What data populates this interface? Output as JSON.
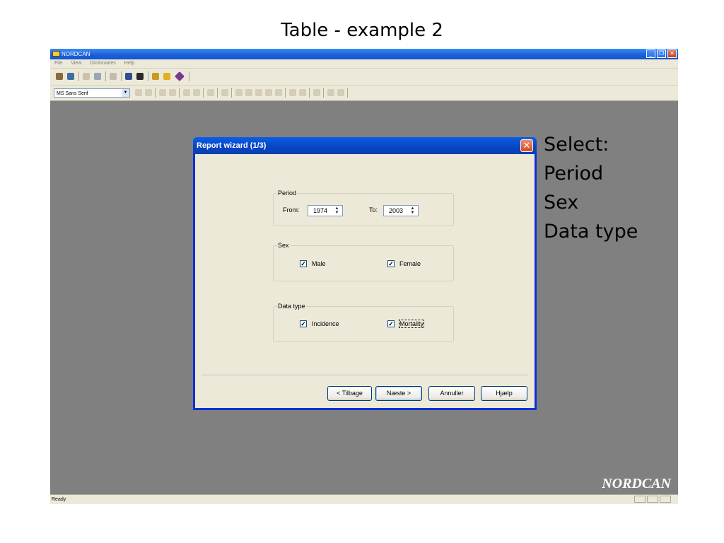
{
  "slide": {
    "title": "Table - example 2",
    "annotation_lines": [
      "Select:",
      "Period",
      "Sex",
      "Data type"
    ]
  },
  "app": {
    "window_title": "NORDCAN",
    "menu": [
      "File",
      "View",
      "Dictionaries",
      "Help"
    ],
    "font_select_value": "MS Sans Serif",
    "brand_watermark": "NORDCAN",
    "status_text": "Ready"
  },
  "dialog": {
    "title": "Report wizard (1/3)",
    "period": {
      "legend": "Period",
      "from_label": "From:",
      "from_value": "1974",
      "to_label": "To:",
      "to_value": "2003"
    },
    "sex": {
      "legend": "Sex",
      "male_label": "Male",
      "male_checked": true,
      "female_label": "Female",
      "female_checked": true
    },
    "data_type": {
      "legend": "Data type",
      "incidence_label": "Incidence",
      "incidence_checked": true,
      "mortality_label": "Mortality",
      "mortality_checked": true
    },
    "buttons": {
      "back": "< Tilbage",
      "next": "Næste >",
      "cancel": "Annuller",
      "help": "Hjælp"
    }
  },
  "icons": [
    "app-icon",
    "minimize-icon",
    "restore-icon",
    "close-icon",
    "dropdown-arrow-icon",
    "spinner-arrows-icon",
    "checkmark-icon"
  ]
}
